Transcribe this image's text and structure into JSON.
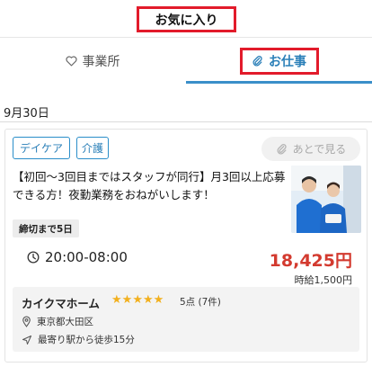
{
  "header": {
    "title": "お気に入り"
  },
  "tabs": {
    "favorite_label": "事業所",
    "jobs_label": "お仕事"
  },
  "date": "9月30日",
  "card": {
    "tags": [
      "デイケア",
      "介護"
    ],
    "later_label": "あとで見る",
    "title": "【初回～3回目まではスタッフが同行】月3回以上応募できる方！夜勤業務をおねがいします！",
    "deadline": "締切まで5日",
    "time": "20:00-08:00",
    "salary": "18,425円",
    "hourly": "時給1,500円",
    "facility": {
      "name": "カイクマホーム",
      "rating_stars": 5,
      "rating_text": "5点 (7件)",
      "location": "東京都大田区",
      "access": "最寄り駅から徒歩15分"
    }
  },
  "colors": {
    "accent": "#2a7fb8",
    "highlight_box": "#e21b2b",
    "salary": "#d33a2f",
    "star": "#f2b01e"
  }
}
